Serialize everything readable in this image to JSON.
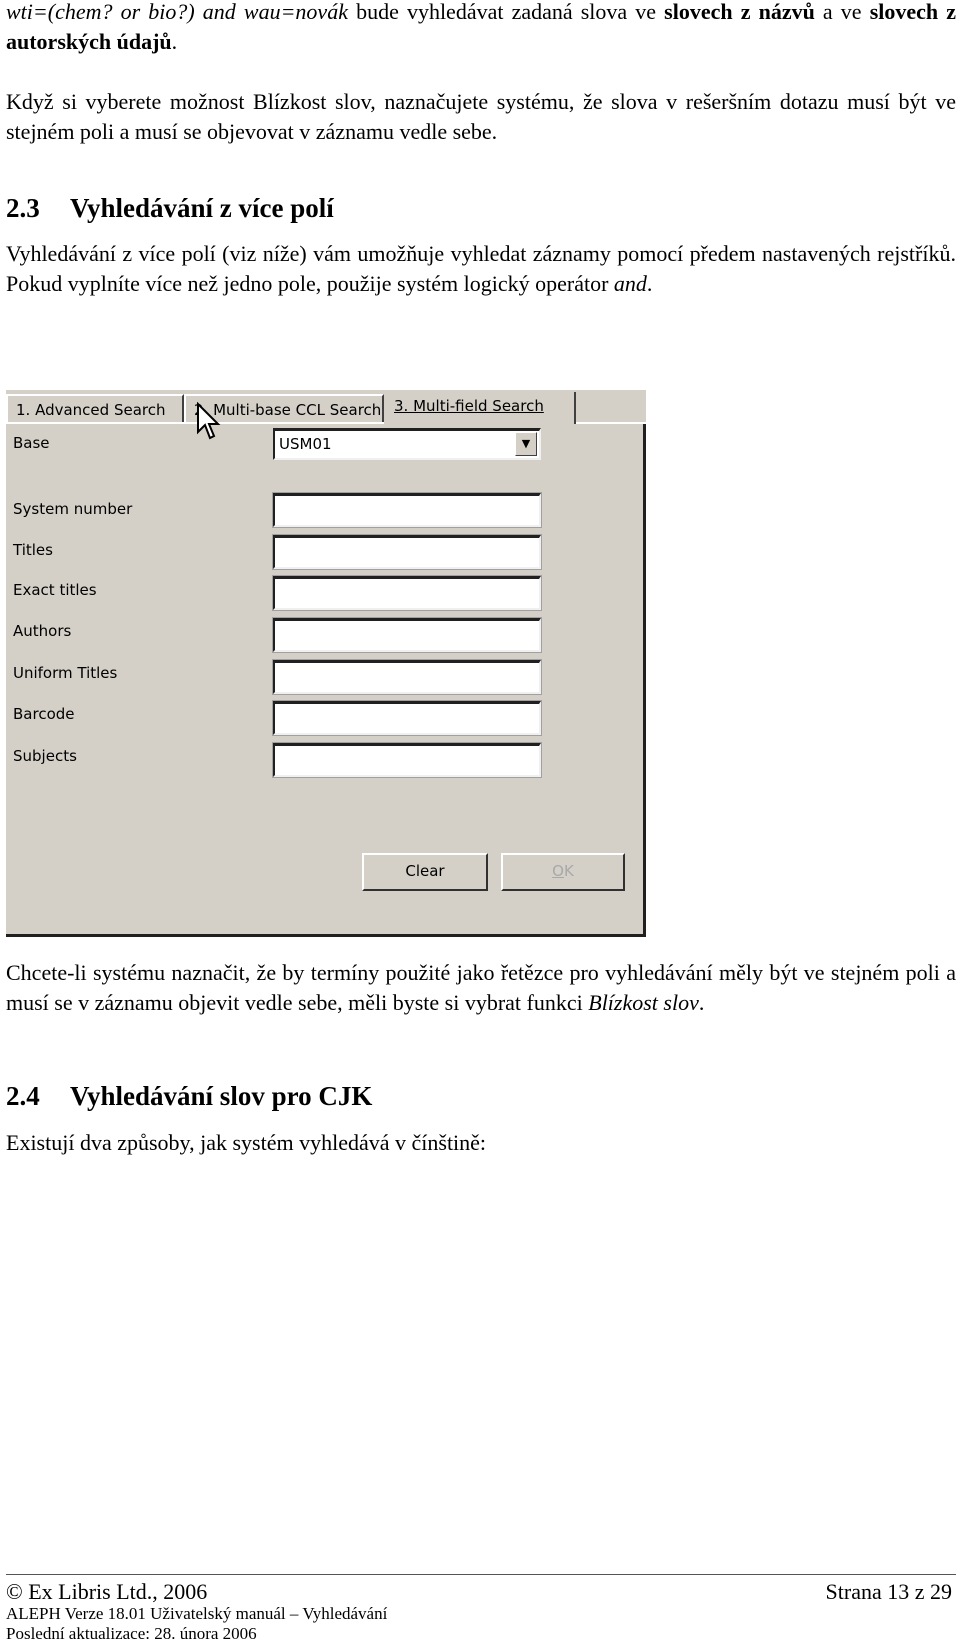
{
  "document": {
    "intro": {
      "query_italic": "wti=(chem? or bio?) and wau=novák",
      "text_1": " bude vyhledávat zadaná slova ve ",
      "bold_1": "slovech z názvů",
      "text_2": " a ve ",
      "bold_2": "slovech z autorských údajů",
      "text_3": "."
    },
    "paragraph_proximity": "Když si vyberete možnost Blízkost slov, naznačujete systému, že slova v rešeršním dotazu musí být ve stejném poli a musí se objevovat v záznamu vedle sebe.",
    "section_2_3": {
      "number": "2.3",
      "title": "Vyhledávání z více polí",
      "body_text": "Vyhledávání z více polí (viz níže) vám umožňuje vyhledat záznamy pomocí předem nastavených rejstříků. Pokud vyplníte více než jedno pole, použije systém logický operátor ",
      "body_italic": "and",
      "body_end": "."
    },
    "paragraph_after_dialog": {
      "text": "Chcete-li systému naznačit, že by termíny použité jako řetězce pro vyhledávání měly být ve stejném poli a musí se v záznamu objevit vedle sebe, měli byste si vybrat funkci ",
      "italic": "Blízkost slov",
      "end": "."
    },
    "section_2_4": {
      "number": "2.4",
      "title": "Vyhledávání slov pro CJK",
      "body": "Existují dva způsoby, jak systém vyhledává v čínštině:"
    }
  },
  "dialog": {
    "tabs": [
      {
        "label": "1. Advanced Search",
        "active": false
      },
      {
        "label": "2. Multi-base CCL Search",
        "active": false
      },
      {
        "label": "3. Multi-field Search",
        "active": true
      }
    ],
    "base": {
      "label": "Base",
      "value": "USM01"
    },
    "fields": [
      {
        "label": "System number",
        "value": ""
      },
      {
        "label": "Titles",
        "value": ""
      },
      {
        "label": "Exact titles",
        "value": ""
      },
      {
        "label": "Authors",
        "value": ""
      },
      {
        "label": "Uniform Titles",
        "value": ""
      },
      {
        "label": "Barcode",
        "value": ""
      },
      {
        "label": "Subjects",
        "value": ""
      }
    ],
    "buttons": {
      "clear": "Clear",
      "ok_mnemonic": "O",
      "ok_rest": "K"
    }
  },
  "footer": {
    "copyright": "© Ex Libris Ltd., 2006",
    "page": "Strana 13 z 29",
    "manual": "ALEPH Verze 18.01 Uživatelský manuál – Vyhledávání",
    "updated": "Poslední aktualizace: 28. února 2006"
  }
}
